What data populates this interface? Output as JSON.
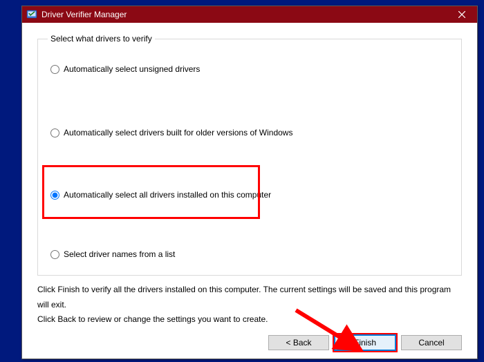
{
  "window": {
    "title": "Driver Verifier Manager"
  },
  "group": {
    "legend": "Select what drivers to verify",
    "options": {
      "opt1": "Automatically select unsigned drivers",
      "opt2": "Automatically select drivers built for older versions of Windows",
      "opt3": "Automatically select all drivers installed on this computer",
      "opt4": "Select driver names from a list"
    }
  },
  "description": {
    "line1": "Click Finish to verify all the drivers installed on this computer. The current settings will be saved and this program will exit.",
    "line2": "Click Back to review or change the settings you want to create."
  },
  "buttons": {
    "back": "< Back",
    "finish": "Finish",
    "cancel": "Cancel"
  },
  "annotation": {
    "highlight_color": "#ff0000",
    "arrow_color": "#ff0000"
  }
}
